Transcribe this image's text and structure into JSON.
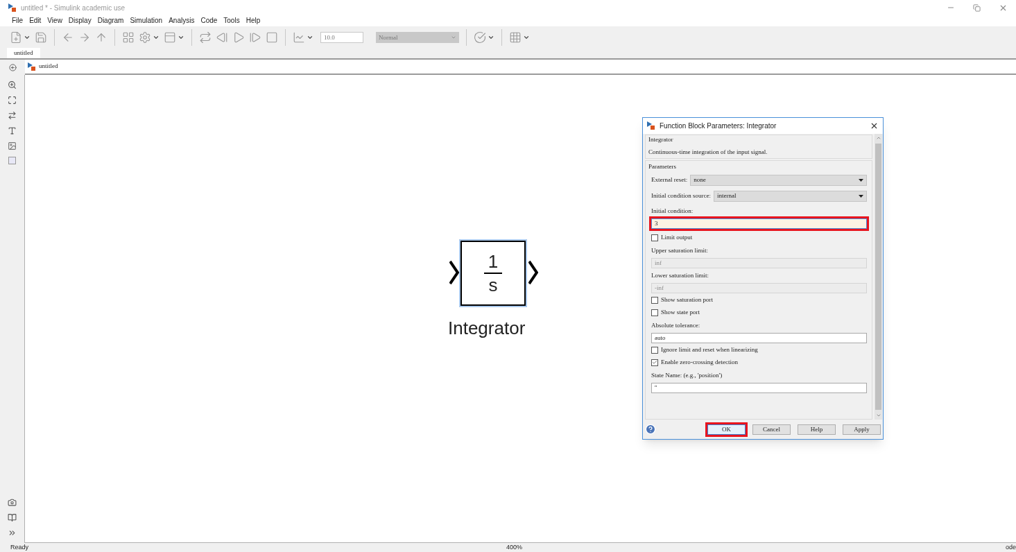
{
  "window": {
    "title": "untitled * - Simulink academic use"
  },
  "menu": [
    "File",
    "Edit",
    "View",
    "Display",
    "Diagram",
    "Simulation",
    "Analysis",
    "Code",
    "Tools",
    "Help"
  ],
  "toolbar": {
    "stop_time": "10.0",
    "simulation_mode": "Normal"
  },
  "tabs": [
    {
      "label": "untitled",
      "selected": true
    }
  ],
  "breadcrumb": "untitled",
  "block": {
    "numerator": "1",
    "denominator": "s",
    "name": "Integrator",
    "selected": true
  },
  "dialog": {
    "title": "Function Block Parameters: Integrator",
    "block_group": "Integrator",
    "description": "Continuous-time integration of the input signal.",
    "parameters_group": "Parameters",
    "fields": [
      {
        "kind": "select",
        "label": "External reset:",
        "value": "none"
      },
      {
        "kind": "select",
        "label": "Initial condition source:",
        "value": "internal"
      },
      {
        "kind": "text",
        "label": "Initial condition:",
        "value": "3",
        "highlighted": true,
        "disabled": false
      },
      {
        "kind": "checkbox",
        "label": "Limit output",
        "checked": false
      },
      {
        "kind": "text",
        "label": "Upper saturation limit:",
        "value": "inf",
        "highlighted": false,
        "disabled": true
      },
      {
        "kind": "text",
        "label": "Lower saturation limit:",
        "value": "-inf",
        "highlighted": false,
        "disabled": true
      },
      {
        "kind": "checkbox",
        "label": "Show saturation port",
        "checked": false
      },
      {
        "kind": "checkbox",
        "label": "Show state port",
        "checked": false
      },
      {
        "kind": "text",
        "label": "Absolute tolerance:",
        "value": "auto",
        "highlighted": false,
        "disabled": false
      },
      {
        "kind": "checkbox",
        "label": "Ignore limit and reset when linearizing",
        "checked": false
      },
      {
        "kind": "checkbox",
        "label": "Enable zero-crossing detection",
        "checked": true
      },
      {
        "kind": "text",
        "label": "State Name: (e.g., 'position')",
        "value": "''",
        "highlighted": false,
        "disabled": false
      }
    ],
    "buttons": [
      {
        "label": "OK",
        "highlighted": true
      },
      {
        "label": "Cancel",
        "highlighted": false
      },
      {
        "label": "Help",
        "highlighted": false
      },
      {
        "label": "Apply",
        "highlighted": false
      }
    ]
  },
  "status_bar": {
    "left": "Ready",
    "center": "400%",
    "right": "ode"
  }
}
